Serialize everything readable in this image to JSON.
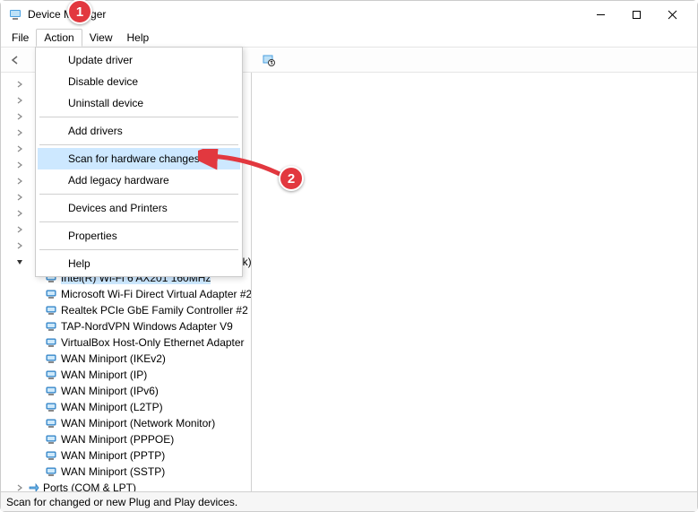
{
  "window": {
    "title": "Device Manager"
  },
  "menubar": {
    "items": [
      "File",
      "Action",
      "View",
      "Help"
    ],
    "open_index": 1
  },
  "dropdown": {
    "items": [
      {
        "label": "Update driver",
        "hover": false
      },
      {
        "label": "Disable device",
        "hover": false
      },
      {
        "label": "Uninstall device",
        "hover": false
      },
      {
        "sep": true
      },
      {
        "label": "Add drivers",
        "hover": false
      },
      {
        "sep": true
      },
      {
        "label": "Scan for hardware changes",
        "hover": true
      },
      {
        "label": "Add legacy hardware",
        "hover": false
      },
      {
        "sep": true
      },
      {
        "label": "Devices and Printers",
        "hover": false
      },
      {
        "sep": true
      },
      {
        "label": "Properties",
        "hover": false
      },
      {
        "sep": true
      },
      {
        "label": "Help",
        "hover": false
      }
    ]
  },
  "tree": {
    "hidden_count_top": 11,
    "visible_truncated_label": "twork)",
    "devices": [
      {
        "label": "Intel(R) Wi-Fi 6 AX201 160MHz",
        "selected": true
      },
      {
        "label": "Microsoft Wi-Fi Direct Virtual Adapter #2",
        "selected": false
      },
      {
        "label": "Realtek PCIe GbE Family Controller #2",
        "selected": false
      },
      {
        "label": "TAP-NordVPN Windows Adapter V9",
        "selected": false
      },
      {
        "label": "VirtualBox Host-Only Ethernet Adapter",
        "selected": false
      },
      {
        "label": "WAN Miniport (IKEv2)",
        "selected": false
      },
      {
        "label": "WAN Miniport (IP)",
        "selected": false
      },
      {
        "label": "WAN Miniport (IPv6)",
        "selected": false
      },
      {
        "label": "WAN Miniport (L2TP)",
        "selected": false
      },
      {
        "label": "WAN Miniport (Network Monitor)",
        "selected": false
      },
      {
        "label": "WAN Miniport (PPPOE)",
        "selected": false
      },
      {
        "label": "WAN Miniport (PPTP)",
        "selected": false
      },
      {
        "label": "WAN Miniport (SSTP)",
        "selected": false
      }
    ],
    "next_category_label": "Ports (COM & LPT)"
  },
  "statusbar": {
    "text": "Scan for changed or new Plug and Play devices."
  },
  "callouts": {
    "c1": "1",
    "c2": "2"
  }
}
